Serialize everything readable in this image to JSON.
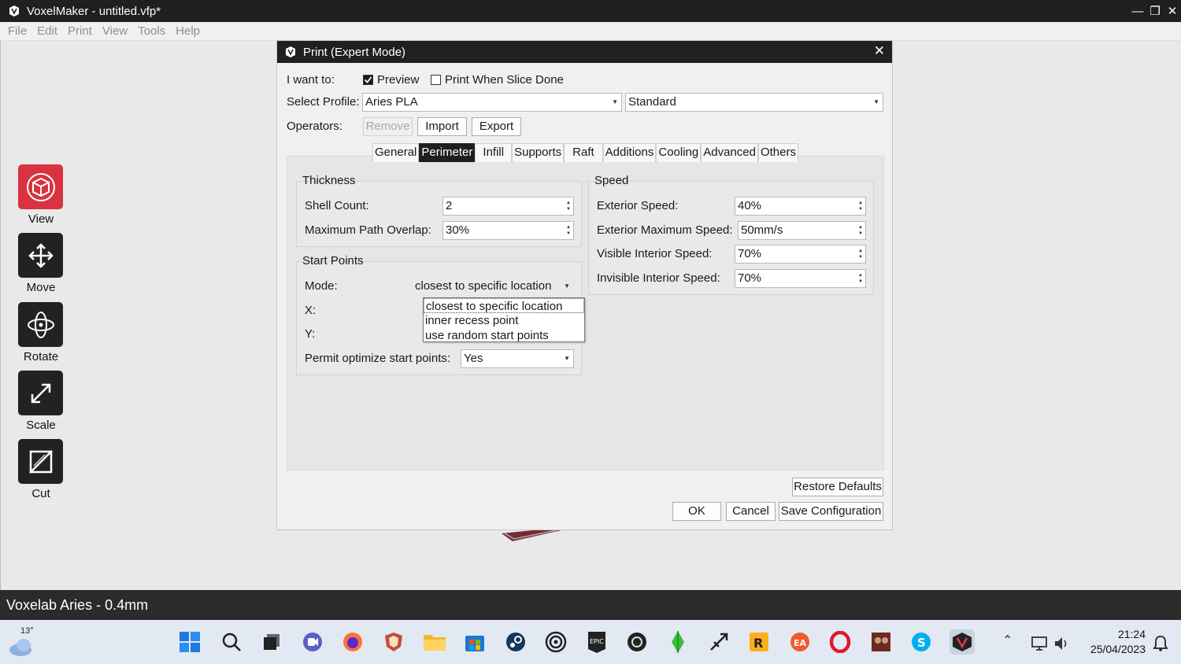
{
  "window": {
    "title": "VoxelMaker - untitled.vfp*"
  },
  "menu": [
    "File",
    "Edit",
    "Print",
    "View",
    "Tools",
    "Help"
  ],
  "tools": [
    {
      "label": "View",
      "icon": "cube-icon",
      "active": true
    },
    {
      "label": "Move",
      "icon": "move-arrows-icon",
      "active": false
    },
    {
      "label": "Rotate",
      "icon": "rotate-icon",
      "active": false
    },
    {
      "label": "Scale",
      "icon": "scale-icon",
      "active": false
    },
    {
      "label": "Cut",
      "icon": "cut-icon",
      "active": false
    }
  ],
  "status": {
    "text": "Voxelab Aries - 0.4mm"
  },
  "dialog": {
    "title": "Print (Expert Mode)",
    "i_want_to_label": "I want to:",
    "preview_label": "Preview",
    "preview_checked": true,
    "print_when_done_label": "Print When Slice Done",
    "print_when_done_checked": false,
    "select_profile_label": "Select Profile:",
    "profile_value": "Aries PLA",
    "quality_value": "Standard",
    "operators_label": "Operators:",
    "remove_label": "Remove",
    "import_label": "Import",
    "export_label": "Export",
    "tabs": [
      "General",
      "Perimeter",
      "Infill",
      "Supports",
      "Raft",
      "Additions",
      "Cooling",
      "Advanced",
      "Others"
    ],
    "active_tab": "Perimeter",
    "thickness": {
      "title": "Thickness",
      "shell_count_label": "Shell Count:",
      "shell_count_value": "2",
      "max_overlap_label": "Maximum Path Overlap:",
      "max_overlap_value": "30%"
    },
    "start_points": {
      "title": "Start Points",
      "mode_label": "Mode:",
      "mode_value": "closest to specific location",
      "x_label": "X:",
      "y_label": "Y:",
      "permit_label": "Permit optimize start points:",
      "permit_value": "Yes",
      "mode_options": [
        "closest to specific location",
        "inner recess point",
        "use random start points"
      ]
    },
    "speed": {
      "title": "Speed",
      "exterior_label": "Exterior Speed:",
      "exterior_value": "40%",
      "exterior_max_label": "Exterior Maximum Speed:",
      "exterior_max_value": "50mm/s",
      "visible_interior_label": "Visible Interior Speed:",
      "visible_interior_value": "70%",
      "invisible_interior_label": "Invisible Interior Speed:",
      "invisible_interior_value": "70%"
    },
    "restore_label": "Restore Defaults",
    "ok_label": "OK",
    "cancel_label": "Cancel",
    "save_label": "Save Configuration"
  },
  "taskbar": {
    "weather_temp": "13°",
    "time": "21:24",
    "date": "25/04/2023"
  }
}
